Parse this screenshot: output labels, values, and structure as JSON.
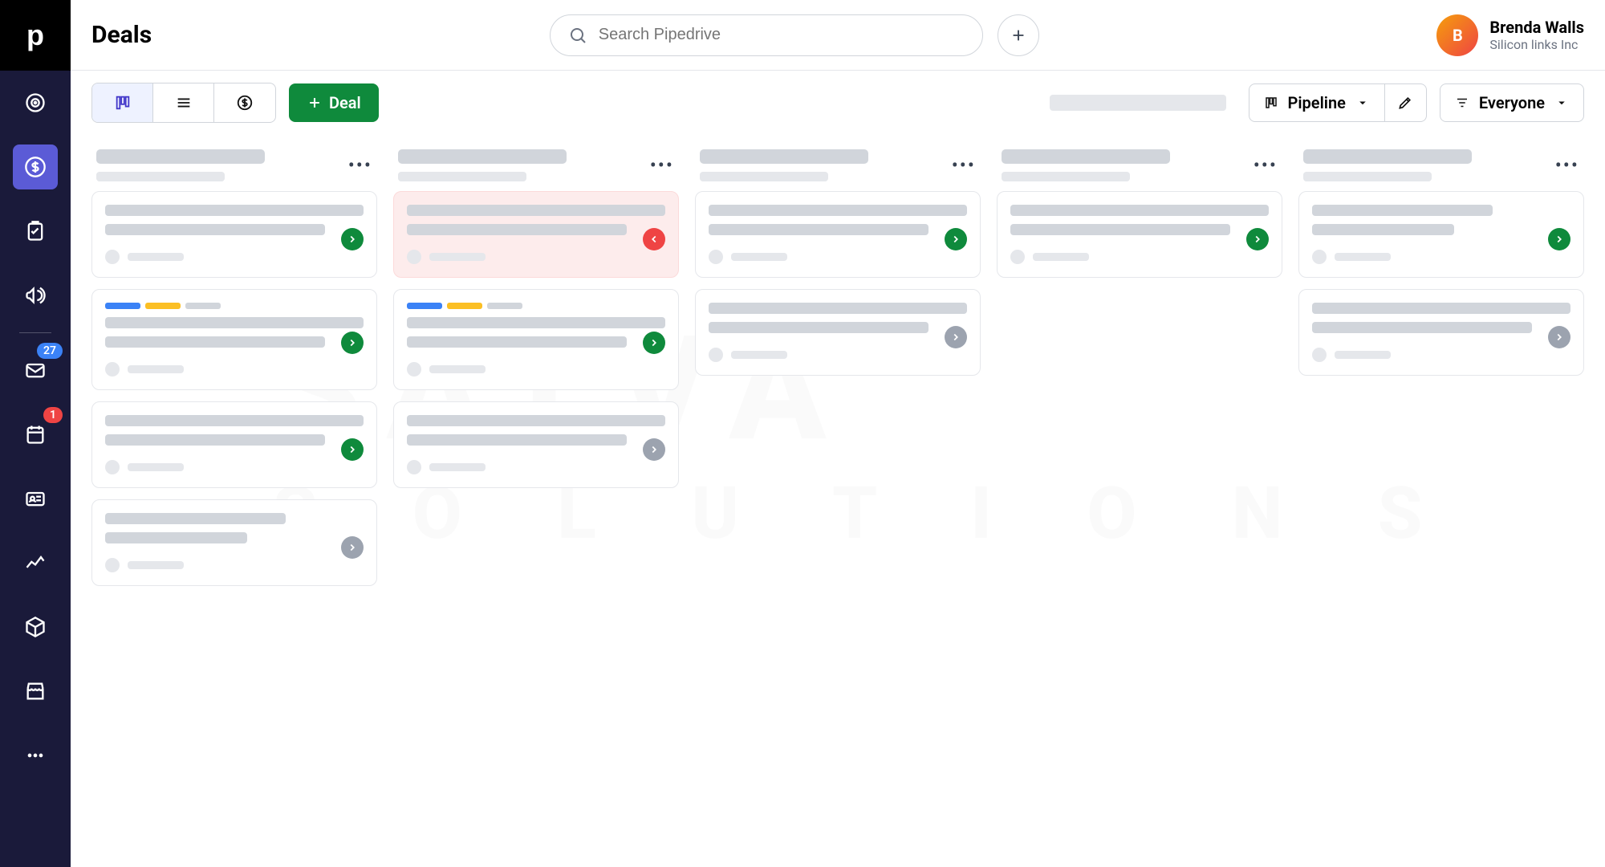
{
  "sidebar": {
    "logo": "p",
    "nav": [
      "target",
      "deals",
      "tasks",
      "campaigns",
      "mail",
      "calendar",
      "contacts",
      "insights",
      "products",
      "marketplace",
      "more"
    ],
    "badges": {
      "mail": "27",
      "calendar": "1"
    },
    "active": "deals"
  },
  "header": {
    "title": "Deals",
    "searchPlaceholder": "Search Pipedrive",
    "user": {
      "name": "Brenda Walls",
      "org": "Silicon links Inc",
      "initials": "B"
    }
  },
  "toolbar": {
    "dealButton": "Deal",
    "pipelineLabel": "Pipeline",
    "filterLabel": "Everyone"
  },
  "board": {
    "columns": [
      {
        "id": "c1",
        "cards": [
          {
            "status": "green"
          },
          {
            "tags": [
              "blue",
              "yellow",
              "gray"
            ],
            "status": "green"
          },
          {
            "status": "green"
          },
          {
            "status": "gray",
            "short": true
          }
        ]
      },
      {
        "id": "c2",
        "cards": [
          {
            "status": "red",
            "alert": true
          },
          {
            "tags": [
              "blue",
              "yellow",
              "gray"
            ],
            "status": "green"
          },
          {
            "status": "gray"
          }
        ]
      },
      {
        "id": "c3",
        "cards": [
          {
            "status": "green"
          },
          {
            "status": "gray"
          }
        ]
      },
      {
        "id": "c4",
        "cards": [
          {
            "status": "green"
          }
        ]
      },
      {
        "id": "c5",
        "cards": [
          {
            "status": "green",
            "short": true
          },
          {
            "status": "gray"
          }
        ]
      }
    ]
  },
  "watermark": {
    "line1": "SATVA",
    "line2": "S O L U T I O N S"
  }
}
